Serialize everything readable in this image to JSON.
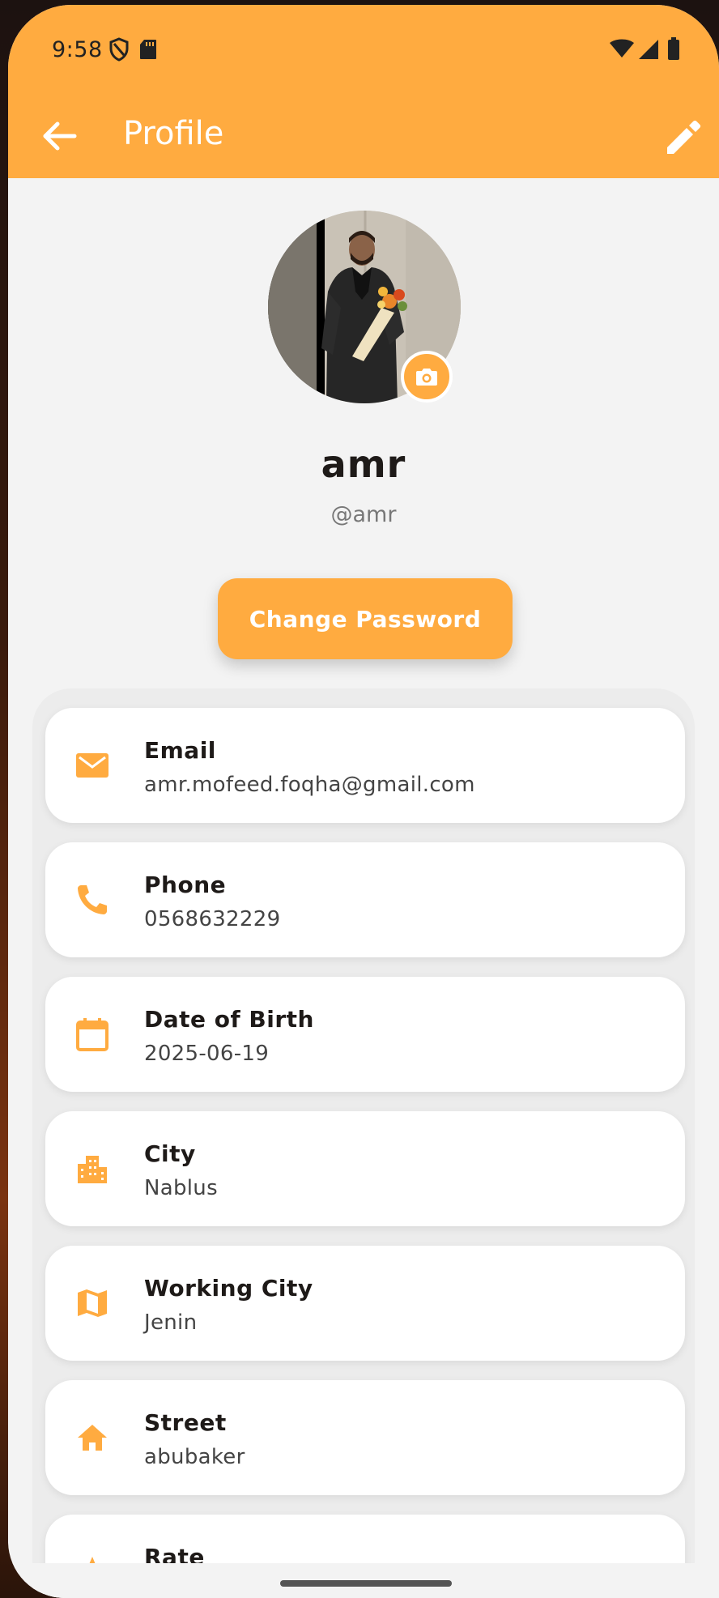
{
  "status_bar": {
    "time": "9:58"
  },
  "app_bar": {
    "title": "Profile"
  },
  "profile": {
    "name": "amr",
    "handle": "@amr",
    "change_password_label": "Change Password"
  },
  "info_cards": [
    {
      "label": "Email",
      "value": "amr.mofeed.foqha@gmail.com",
      "icon": "email-icon"
    },
    {
      "label": "Phone",
      "value": "0568632229",
      "icon": "phone-icon"
    },
    {
      "label": "Date of Birth",
      "value": "2025-06-19",
      "icon": "calendar-icon"
    },
    {
      "label": "City",
      "value": "Nablus",
      "icon": "city-icon"
    },
    {
      "label": "Working City",
      "value": "Jenin",
      "icon": "map-icon"
    },
    {
      "label": "Street",
      "value": "abubaker",
      "icon": "home-icon"
    },
    {
      "label": "Rate",
      "value": "",
      "icon": "star-icon"
    }
  ],
  "colors": {
    "accent": "#ffab40",
    "background": "#f3f3f3",
    "text_dark": "#1e1a18"
  }
}
